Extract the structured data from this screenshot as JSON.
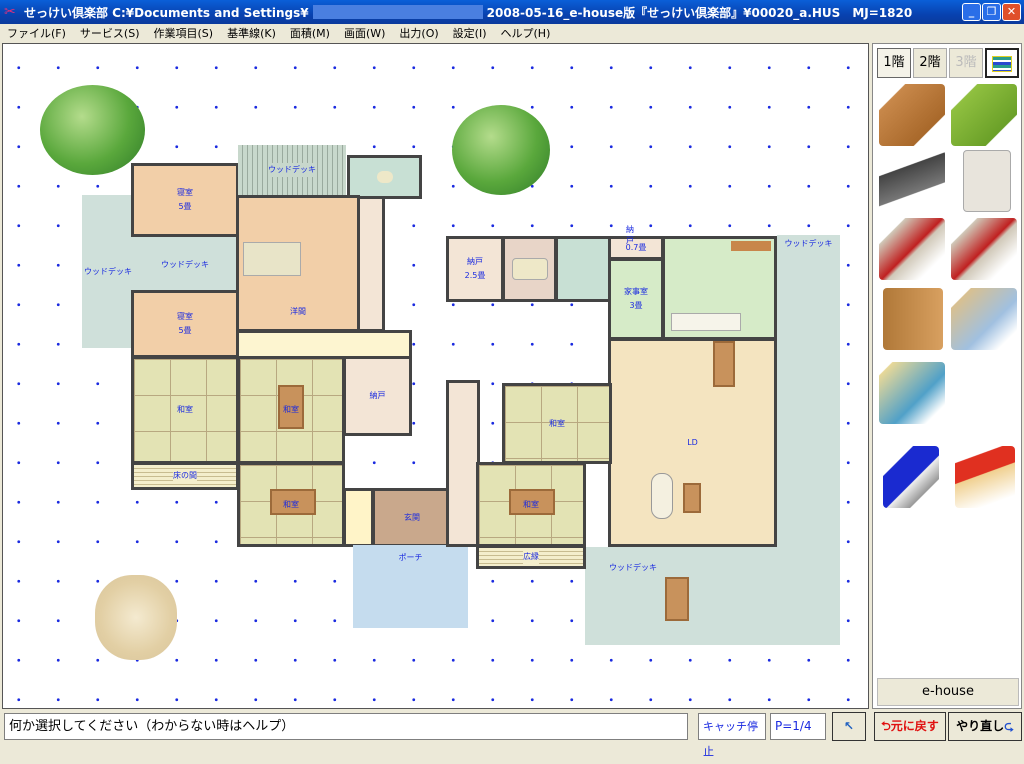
{
  "window": {
    "title": "せっけい倶楽部 C:¥Documents and Settings¥",
    "title_file": "2008-05-16_e-house版『せっけい倶楽部』¥00020_a.HUS　MJ=1820",
    "minimize": "_",
    "maximize": "❐",
    "close": "✕"
  },
  "menu": [
    "ファイル(F)",
    "サービス(S)",
    "作業項目(S)",
    "基準線(K)",
    "面積(M)",
    "画面(W)",
    "出力(O)",
    "設定(I)",
    "ヘルプ(H)"
  ],
  "plan": {
    "rooms": {
      "deck_left": "ウッドデッキ",
      "bedroom1": "寝室",
      "bedroom1_size": "5畳",
      "deck_mid": "ウッドデッキ",
      "bedroom2": "寝室",
      "bedroom2_size": "5畳",
      "deck_top": "ウッドデッキ",
      "western": "洋間",
      "washitsu1": "和室",
      "tokonoma": "床の間",
      "washitsu2": "和室",
      "nando1": "納戸",
      "washitsu3": "和室",
      "genkan": "玄関",
      "porch": "ポーチ",
      "nando2": "納戸",
      "nando2_size": "2.5畳",
      "nando3": "納戸",
      "nando3_size": "0.7畳",
      "kaji": "家事室",
      "kaji_size": "3畳",
      "ld": "LD",
      "washitsu4": "和室",
      "washitsu5": "和室",
      "hiroen": "広縁",
      "deck_right": "ウッドデッキ",
      "deck_bottom": "ウッドデッキ"
    }
  },
  "panel": {
    "floors": [
      "1階",
      "2階",
      "3階"
    ],
    "active_floor": "1階",
    "disabled_floor": "3階",
    "layers_icon": "layers-icon",
    "brand_button": "e-house",
    "tools": [
      "floor-tool-icon",
      "lawn-tool-icon",
      "roof-tool-icon",
      "wall-tool-icon",
      "stair-tool-icon",
      "stair-turn-tool-icon",
      "door-tool-icon",
      "furniture-tool-icon",
      "room-3d-icon",
      "blank-tool-icon",
      "eraser-tool-icon",
      "move-tool-icon"
    ]
  },
  "status": {
    "message": "何か選択してください（わからない時はヘルプ）",
    "snap": "キャッチ停止",
    "page": "P=1/4",
    "undo": "元に戻す",
    "redo": "やり直し"
  },
  "colors": {
    "titlebar": "#0842b0",
    "grid_dot": "#1a2ae0",
    "label": "#1a2ae0"
  }
}
